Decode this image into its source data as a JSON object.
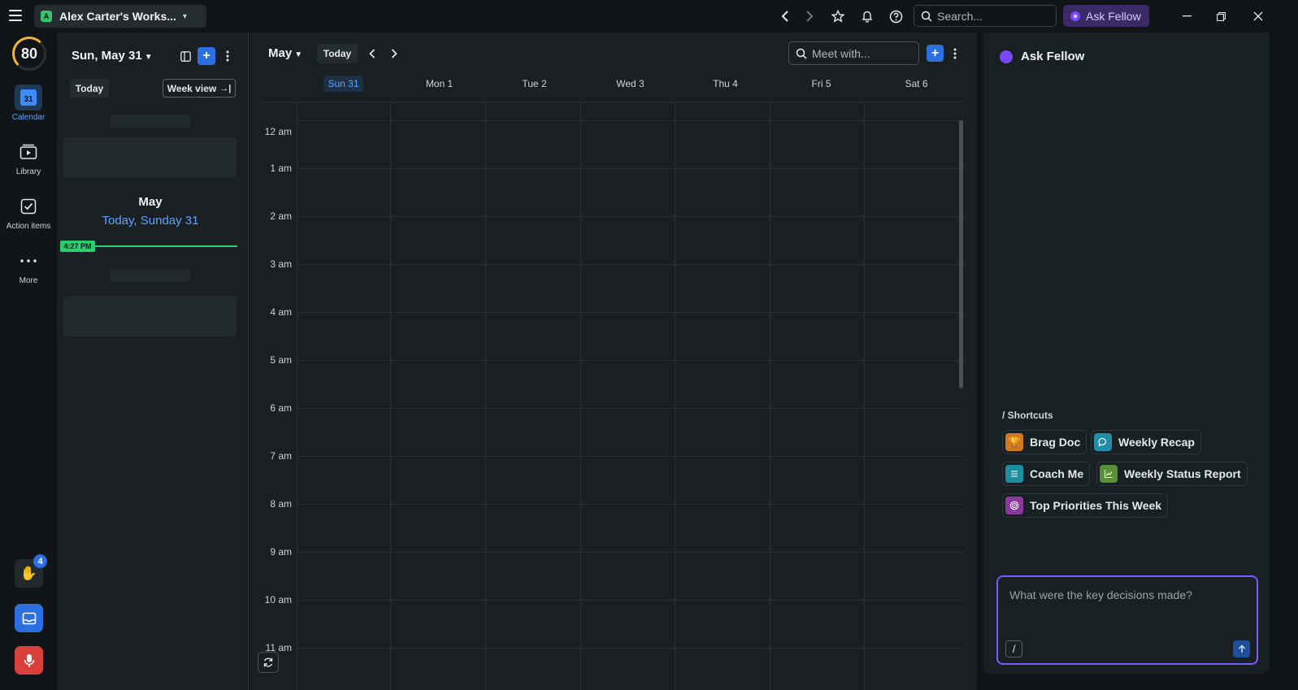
{
  "titlebar": {
    "workspace_badge": "A",
    "workspace_name": "Alex Carter's Works...",
    "search_placeholder": "Search...",
    "ask_fellow": "Ask Fellow"
  },
  "rail": {
    "score": "80",
    "items": [
      {
        "label": "Calendar",
        "day": "31"
      },
      {
        "label": "Library"
      },
      {
        "label": "Action items"
      },
      {
        "label": "More"
      }
    ],
    "wave_count": "4"
  },
  "agenda": {
    "date": "Sun, May 31",
    "today": "Today",
    "week_view": "Week view",
    "month": "May",
    "today_label": "Today, Sunday 31",
    "now_time": "4:27 PM"
  },
  "calendar": {
    "month": "May",
    "today": "Today",
    "meet_placeholder": "Meet with...",
    "days": [
      "Sun 31",
      "Mon 1",
      "Tue 2",
      "Wed 3",
      "Thu 4",
      "Fri 5",
      "Sat 6"
    ],
    "hours": [
      "12 am",
      "1 am",
      "2 am",
      "3 am",
      "4 am",
      "5 am",
      "6 am",
      "7 am",
      "8 am",
      "9 am",
      "10 am",
      "11 am"
    ]
  },
  "fellow": {
    "title": "Ask Fellow",
    "shortcuts_label": "/ Shortcuts",
    "shortcuts": [
      "Brag Doc",
      "Weekly Recap",
      "Coach Me",
      "Weekly Status Report",
      "Top Priorities This Week"
    ],
    "input_placeholder": "What were the key decisions made?"
  },
  "colors": {
    "accent_blue": "#2c6fe0",
    "now_green": "#2ecc71",
    "fellow_purple": "#7a5cff"
  }
}
